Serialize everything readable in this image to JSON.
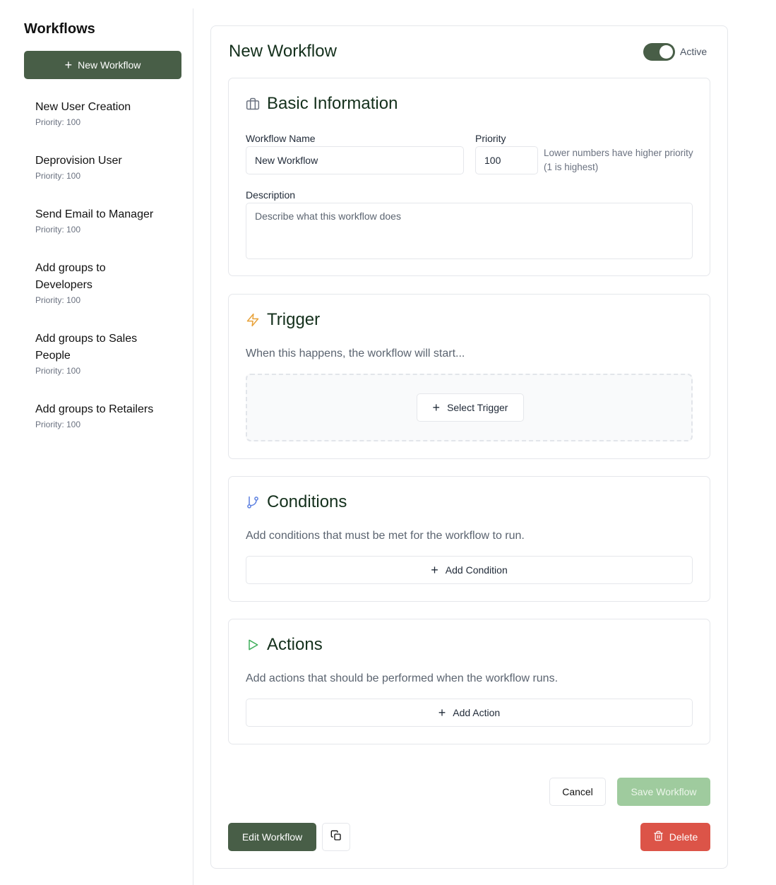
{
  "sidebar": {
    "title": "Workflows",
    "new_button_label": "New Workflow",
    "items": [
      {
        "name": "New User Creation",
        "priority": "Priority: 100"
      },
      {
        "name": "Deprovision User",
        "priority": "Priority: 100"
      },
      {
        "name": "Send Email to Manager",
        "priority": "Priority: 100"
      },
      {
        "name": "Add groups to Developers",
        "priority": "Priority: 100"
      },
      {
        "name": "Add groups to Sales People",
        "priority": "Priority: 100"
      },
      {
        "name": "Add groups to Retailers",
        "priority": "Priority: 100"
      }
    ]
  },
  "editor": {
    "title": "New Workflow",
    "active_label": "Active",
    "active": true
  },
  "basic_info": {
    "title": "Basic Information",
    "name_label": "Workflow Name",
    "name_value": "New Workflow",
    "priority_label": "Priority",
    "priority_value": "100",
    "priority_hint": "Lower numbers have higher priority (1 is highest)",
    "description_label": "Description",
    "description_placeholder": "Describe what this workflow does"
  },
  "trigger": {
    "title": "Trigger",
    "description": "When this happens, the workflow will start...",
    "button_label": "Select Trigger"
  },
  "conditions": {
    "title": "Conditions",
    "description": "Add conditions that must be met for the workflow to run.",
    "button_label": "Add Condition"
  },
  "actions": {
    "title": "Actions",
    "description": "Add actions that should be performed when the workflow runs.",
    "button_label": "Add Action"
  },
  "footer": {
    "cancel_label": "Cancel",
    "save_label": "Save Workflow",
    "edit_label": "Edit Workflow",
    "delete_label": "Delete"
  },
  "colors": {
    "primary": "#485e47",
    "save_disabled": "#9fcb9e",
    "danger": "#dc5448",
    "trigger_icon": "#e8a23a",
    "conditions_icon": "#5b7fe0",
    "actions_icon": "#3fae5b"
  },
  "icons": {
    "basic_info": "briefcase-icon",
    "trigger": "lightning-icon",
    "conditions": "git-branch-icon",
    "actions": "play-icon",
    "copy": "copy-icon",
    "delete": "trash-icon",
    "add": "plus-icon"
  }
}
